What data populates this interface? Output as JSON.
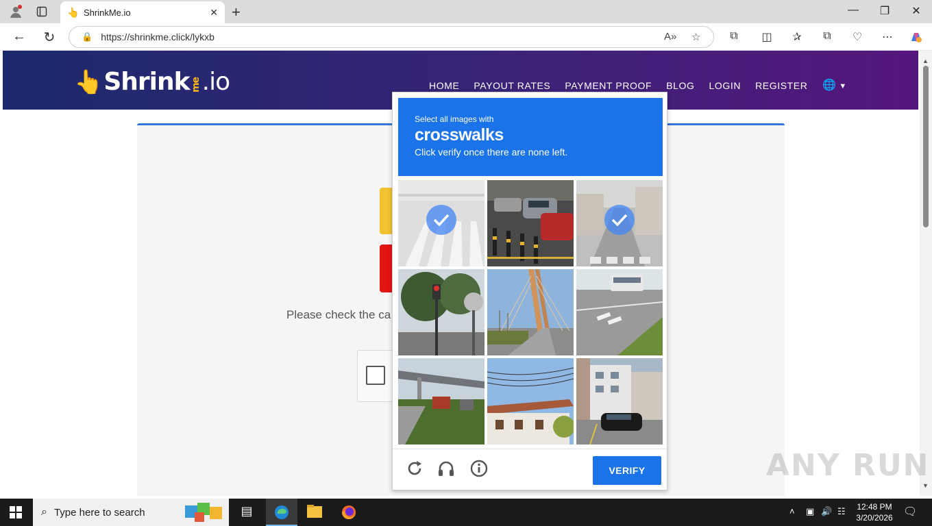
{
  "browser": {
    "tab_title": "ShrinkMe.io",
    "url": "https://shrinkme.click/lykxb",
    "read_aloud_label": "A»",
    "icons": [
      "profile-icon",
      "tab-actions-icon",
      "back-icon",
      "refresh-icon",
      "lock-icon",
      "favorite-icon",
      "extensions-icon",
      "split-screen-icon",
      "favorites-icon",
      "collections-icon",
      "browser-essentials-icon",
      "more-icon",
      "copilot-icon"
    ]
  },
  "site": {
    "logo_main": "Shrink",
    "logo_me": "me",
    "logo_io": ".io",
    "nav": [
      "HOME",
      "PAYOUT RATES",
      "PAYMENT PROOF",
      "BLOG",
      "LOGIN",
      "REGISTER"
    ],
    "page_text": "Please check the ca"
  },
  "captcha": {
    "prompt_line1": "Select all images with",
    "prompt_target": "crosswalks",
    "prompt_line3": "Click verify once there are none left.",
    "tiles": [
      {
        "index": 1,
        "selected": true
      },
      {
        "index": 2,
        "selected": false
      },
      {
        "index": 3,
        "selected": true
      },
      {
        "index": 4,
        "selected": false
      },
      {
        "index": 5,
        "selected": false
      },
      {
        "index": 6,
        "selected": false
      },
      {
        "index": 7,
        "selected": false
      },
      {
        "index": 8,
        "selected": false
      },
      {
        "index": 9,
        "selected": false
      }
    ],
    "verify_label": "VERIFY",
    "accent_color": "#1a73e8"
  },
  "watermark": "ANY RUN",
  "taskbar": {
    "search_placeholder": "Type here to search",
    "time": "12:48 PM",
    "date": "3/20/2026"
  }
}
